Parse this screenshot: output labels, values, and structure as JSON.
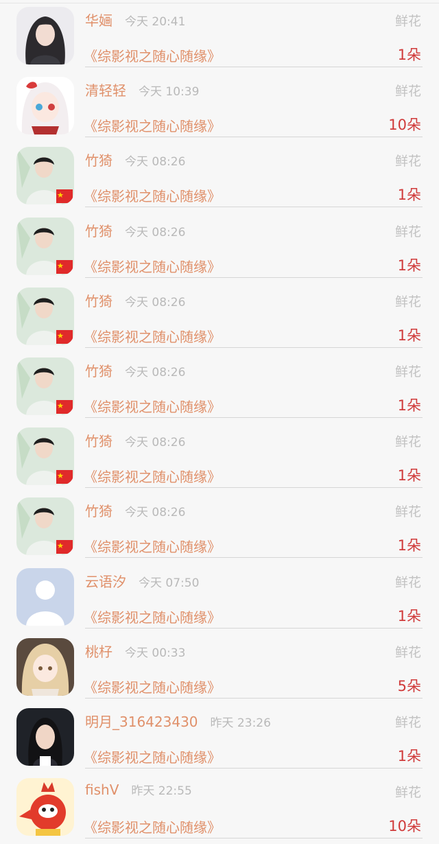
{
  "gift_type_label": "鲜花",
  "records": [
    {
      "user": "华婳",
      "time": "今天 20:41",
      "book": "《综影视之随心随缘》",
      "count": "1朵",
      "avatar": "girl-dark-hair"
    },
    {
      "user": "清轻轻",
      "time": "今天 10:39",
      "book": "《综影视之随心随缘》",
      "count": "10朵",
      "avatar": "anime-girl-white-hair"
    },
    {
      "user": "竹猗",
      "time": "今天 08:26",
      "book": "《综影视之随心随缘》",
      "count": "1朵",
      "avatar": "man-with-flag"
    },
    {
      "user": "竹猗",
      "time": "今天 08:26",
      "book": "《综影视之随心随缘》",
      "count": "1朵",
      "avatar": "man-with-flag"
    },
    {
      "user": "竹猗",
      "time": "今天 08:26",
      "book": "《综影视之随心随缘》",
      "count": "1朵",
      "avatar": "man-with-flag"
    },
    {
      "user": "竹猗",
      "time": "今天 08:26",
      "book": "《综影视之随心随缘》",
      "count": "1朵",
      "avatar": "man-with-flag"
    },
    {
      "user": "竹猗",
      "time": "今天 08:26",
      "book": "《综影视之随心随缘》",
      "count": "1朵",
      "avatar": "man-with-flag"
    },
    {
      "user": "竹猗",
      "time": "今天 08:26",
      "book": "《综影视之随心随缘》",
      "count": "1朵",
      "avatar": "man-with-flag"
    },
    {
      "user": "云语汐",
      "time": "今天 07:50",
      "book": "《综影视之随心随缘》",
      "count": "1朵",
      "avatar": "default-person"
    },
    {
      "user": "桃杍",
      "time": "今天 00:33",
      "book": "《综影视之随心随缘》",
      "count": "5朵",
      "avatar": "anime-girl-blonde"
    },
    {
      "user": "明月_316423430",
      "time": "昨天 23:26",
      "book": "《综影视之随心随缘》",
      "count": "1朵",
      "avatar": "woman-dark-bg"
    },
    {
      "user": "fishV",
      "time": "昨天 22:55",
      "book": "《综影视之随心随缘》",
      "count": "10朵",
      "avatar": "red-mascot"
    }
  ],
  "colors": {
    "username": "#e0906a",
    "book": "#e0906a",
    "count": "#d03a3a",
    "muted": "#b9b9b9",
    "background": "#f7f7f7"
  }
}
